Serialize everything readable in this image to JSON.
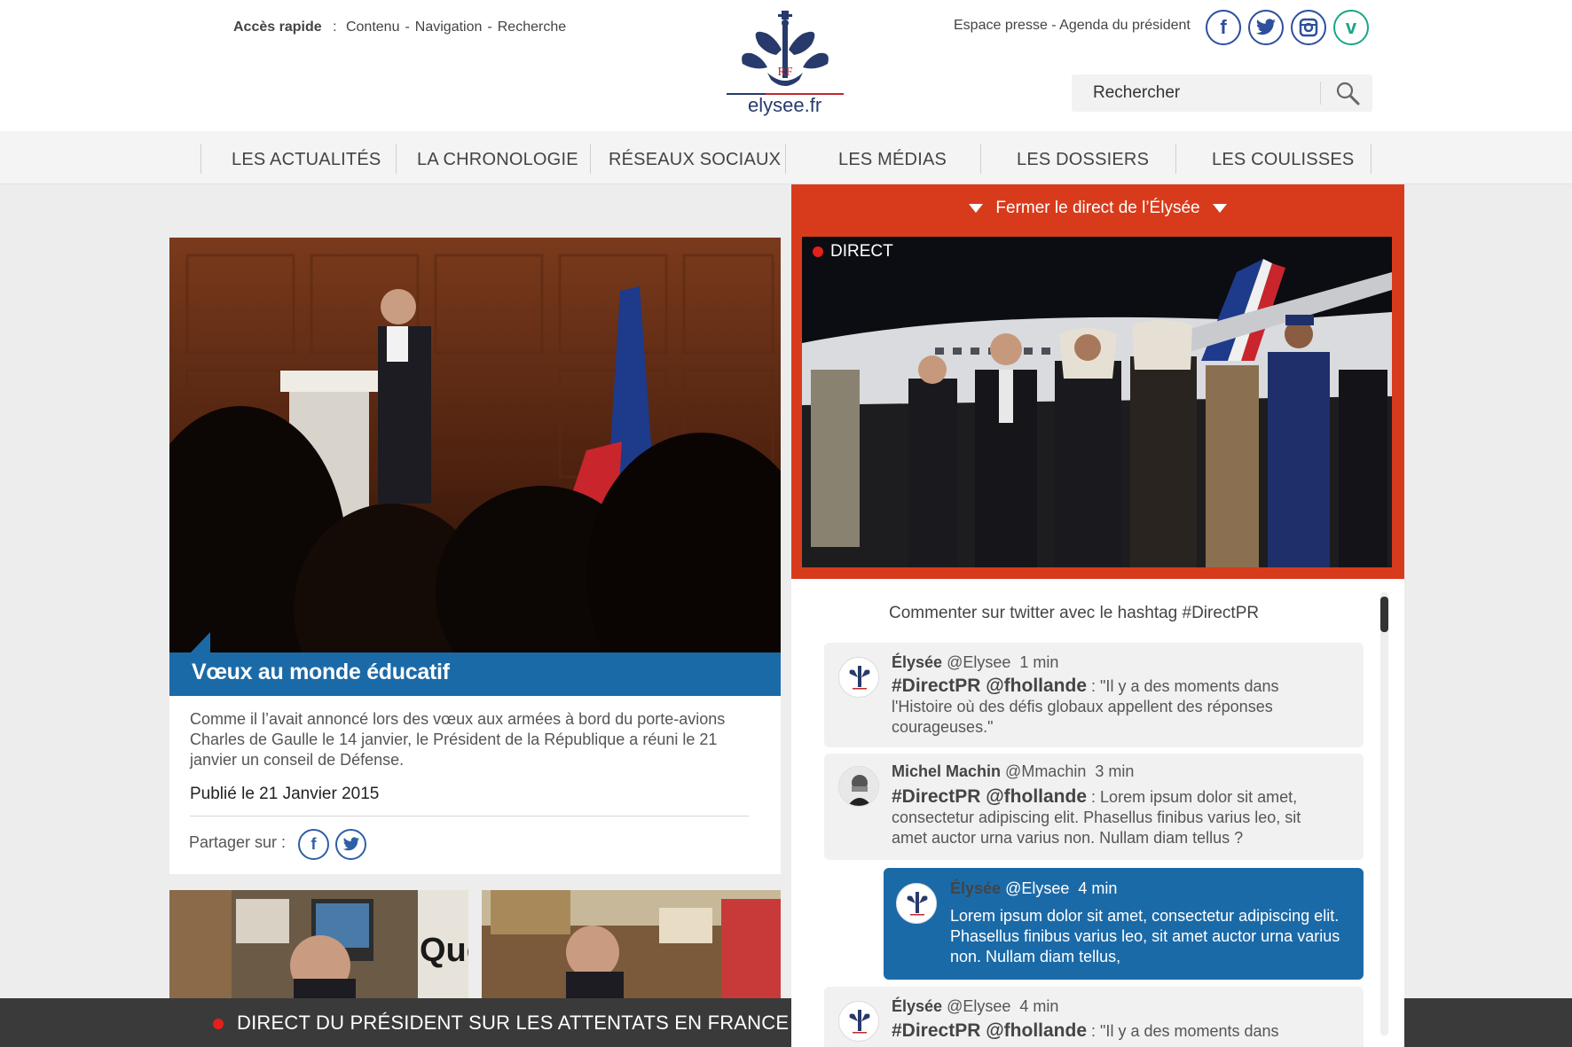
{
  "header": {
    "quick_access": {
      "label": "Accès rapide",
      "colon": ":",
      "links": [
        "Contenu",
        "Navigation",
        "Recherche"
      ],
      "sep": "-"
    },
    "logo_text": "elysee.fr",
    "press_links": "Espace presse - Agenda du président",
    "social": [
      {
        "name": "facebook",
        "glyph": "f"
      },
      {
        "name": "twitter",
        "glyph": "t"
      },
      {
        "name": "instagram",
        "glyph": "◙"
      },
      {
        "name": "vine",
        "glyph": "v"
      }
    ],
    "search": {
      "placeholder": "Rechercher"
    }
  },
  "nav": {
    "items": [
      "LES ACTUALITÉS",
      "LA CHRONOLOGIE",
      "RÉSEAUX SOCIAUX",
      "LES MÉDIAS",
      "LES DOSSIERS",
      "LES COULISSES"
    ]
  },
  "feature": {
    "title": "Vœux au monde éducatif",
    "body": "Comme il l’avait annoncé lors des vœux aux armées à bord du porte-avions Charles de Gaulle le 14 janvier, le Président de la République a réuni le 21 janvier un conseil de Défense.",
    "date": "Publié le 21 Janvier 2015",
    "share_label": "Partager sur :"
  },
  "ticker": {
    "text": "DIRECT DU PRÉSIDENT SUR LES ATTENTATS EN FRANCE"
  },
  "live": {
    "close_label": "Fermer le direct de l’Élysée",
    "badge": "DIRECT",
    "feed_title": "Commenter sur twitter avec le hashtag #DirectPR",
    "tweets": [
      {
        "name": "Élysée",
        "handle": "@Elysee",
        "time": "1 min",
        "tag": "#DirectPR @fhollande",
        "sep": " : ",
        "text": "\"Il y a des moments dans l'Histoire où des défis globaux appellent des réponses courageuses.\""
      },
      {
        "name": "Michel Machin",
        "handle": "@Mmachin",
        "time": "3 min",
        "tag": "#DirectPR @fhollande",
        "sep": " : ",
        "text": "Lorem ipsum dolor sit amet, consectetur adipiscing elit. Phasellus finibus varius leo, sit amet auctor urna varius non. Nullam diam tellus ?"
      },
      {
        "name": "Élysée",
        "handle": "@Elysee",
        "time": "4 min",
        "text": "Lorem ipsum dolor sit amet, consectetur adipiscing elit. Phasellus finibus varius leo, sit amet auctor urna varius non. Nullam diam tellus,"
      },
      {
        "name": "Élysée",
        "handle": "@Elysee",
        "time": "4 min",
        "tag": "#DirectPR @fhollande",
        "sep": " : ",
        "text": "\"Il y a des moments dans"
      }
    ]
  },
  "colors": {
    "accent_blue": "#1b6aa8",
    "live_red": "#d83b1c",
    "ticker_bg": "#3a3a3a",
    "brand_navy": "#273a6b"
  }
}
